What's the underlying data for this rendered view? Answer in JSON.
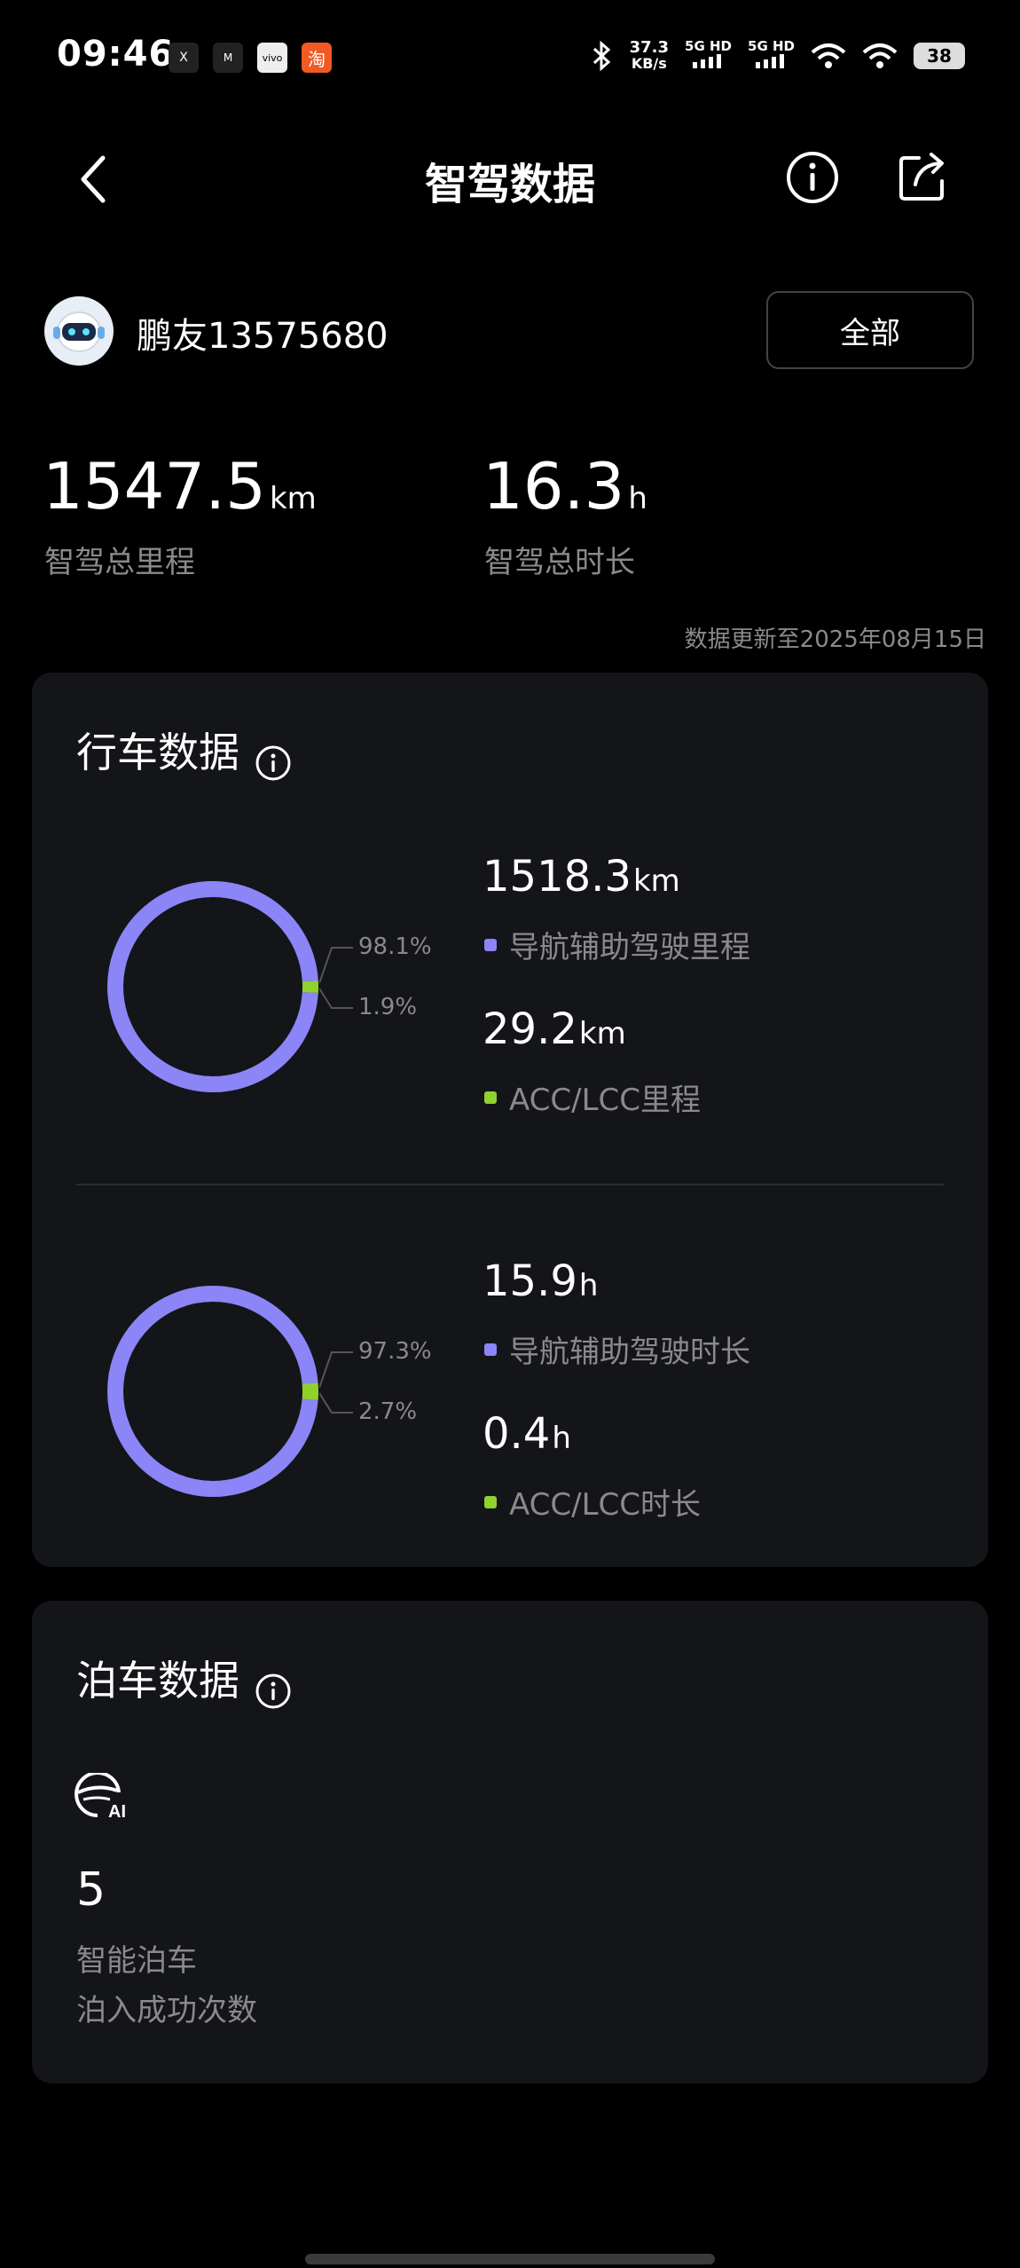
{
  "status_bar": {
    "time": "09:46",
    "speed_value": "37.3",
    "speed_unit": "KB/s",
    "signal1": "5G HD",
    "signal2": "5G HD",
    "battery": "38",
    "app1": "X",
    "app2": "M",
    "app3": "vivo",
    "app4": "淘"
  },
  "header": {
    "title": "智驾数据"
  },
  "user": {
    "name": "鹏友13575680",
    "filter_label": "全部"
  },
  "totals": {
    "distance_value": "1547.5",
    "distance_unit": "km",
    "distance_label": "智驾总里程",
    "duration_value": "16.3",
    "duration_unit": "h",
    "duration_label": "智驾总时长",
    "updated": "数据更新至2025年08月15日"
  },
  "driving": {
    "title": "行车数据",
    "distance_chart": {
      "primary_pct_label": "98.1%",
      "secondary_pct_label": "1.9%",
      "primary_value": "1518.3",
      "primary_unit": "km",
      "primary_label": "导航辅助驾驶里程",
      "secondary_value": "29.2",
      "secondary_unit": "km",
      "secondary_label": "ACC/LCC里程",
      "primary_fraction": 0.981,
      "secondary_fraction": 0.019
    },
    "duration_chart": {
      "primary_pct_label": "97.3%",
      "secondary_pct_label": "2.7%",
      "primary_value": "15.9",
      "primary_unit": "h",
      "primary_label": "导航辅助驾驶时长",
      "secondary_value": "0.4",
      "secondary_unit": "h",
      "secondary_label": "ACC/LCC时长",
      "primary_fraction": 0.973,
      "secondary_fraction": 0.027
    }
  },
  "parking": {
    "title": "泊车数据",
    "count": "5",
    "label1": "智能泊车",
    "label2": "泊入成功次数"
  },
  "colors": {
    "primary": "#8b85f7",
    "secondary": "#8fd12d",
    "card": "#141519"
  }
}
